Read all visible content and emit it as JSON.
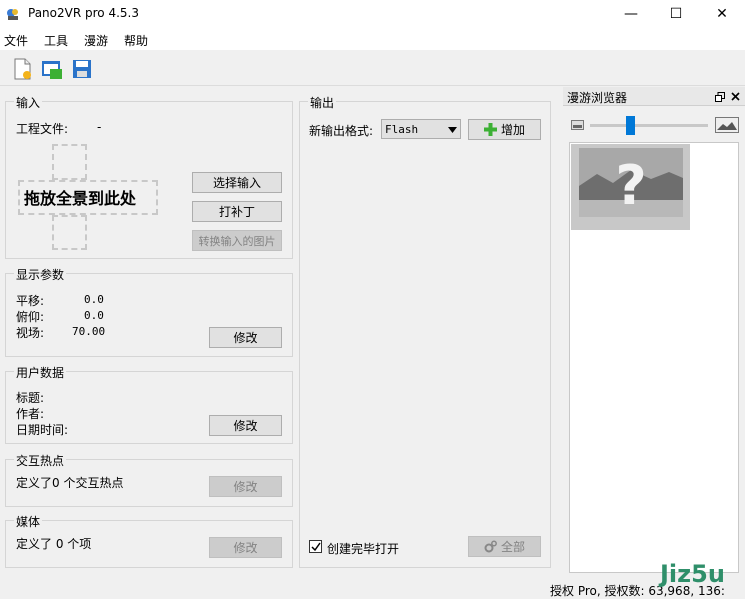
{
  "window": {
    "title": "Pano2VR pro 4.5.3",
    "minimize_glyph": "—",
    "maximize_glyph": "☐",
    "close_glyph": "✕"
  },
  "menu": {
    "items": [
      "文件",
      "工具",
      "漫游",
      "帮助"
    ]
  },
  "toolbar": {
    "icons": [
      "new-project-icon",
      "open-project-icon",
      "save-project-icon"
    ]
  },
  "input_group": {
    "title": "输入",
    "project_file_label": "工程文件:",
    "project_file_value": "-",
    "drop_text": "拖放全景到此处",
    "select_input_label": "选择输入",
    "patch_label": "打补丁",
    "convert_label": "转换输入的图片"
  },
  "display_group": {
    "title": "显示参数",
    "pan_label": "平移:",
    "pan_value": "0.0",
    "tilt_label": "俯仰:",
    "tilt_value": "0.0",
    "fov_label": "视场:",
    "fov_value": "70.00",
    "modify_label": "修改"
  },
  "user_group": {
    "title": "用户数据",
    "title_label": "标题:",
    "author_label": "作者:",
    "date_label": "日期时间:",
    "modify_label": "修改"
  },
  "hotspot_group": {
    "title": "交互热点",
    "defined_text": "定义了0 个交互热点",
    "modify_label": "修改"
  },
  "media_group": {
    "title": "媒体",
    "defined_text": "定义了 0 个项",
    "modify_label": "修改"
  },
  "output_group": {
    "title": "输出",
    "format_label": "新输出格式:",
    "format_value": "Flash",
    "add_label": "增加",
    "open_after_label": "创建完毕打开",
    "open_after_checked": true,
    "all_label": "全部"
  },
  "tour_browser": {
    "title": "漫游浏览器",
    "slider_level": 0.33
  },
  "statusbar": {
    "text": "授权 Pro, 授权数: 63,968, 136:"
  },
  "watermark": {
    "text": "Jiz5u"
  },
  "colors": {
    "accent": "#0078d7",
    "add_green": "#3cb034",
    "disabled_text": "#838383"
  }
}
